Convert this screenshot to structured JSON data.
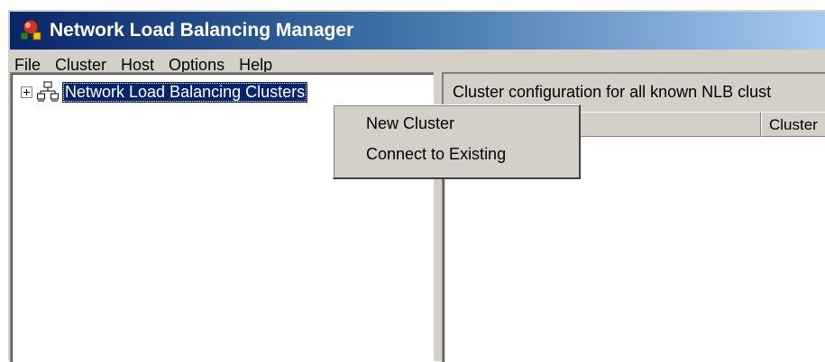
{
  "window": {
    "title": "Network Load Balancing Manager",
    "colors": {
      "title_gradient_start": "#0a246a",
      "title_gradient_end": "#a6caf0",
      "face": "#d4d0c8",
      "selection": "#0a246a"
    }
  },
  "menubar": {
    "items": [
      {
        "label": "File"
      },
      {
        "label": "Cluster"
      },
      {
        "label": "Host"
      },
      {
        "label": "Options"
      },
      {
        "label": "Help"
      }
    ]
  },
  "tree": {
    "root_label": "Network Load Balancing Clusters",
    "root_icon": "network-clusters-icon",
    "expanded": false
  },
  "right_pane": {
    "description": "Cluster configuration for all known NLB clust",
    "columns": [
      {
        "label": ""
      },
      {
        "label": "Cluster"
      }
    ]
  },
  "context_menu": {
    "items": [
      {
        "label": "New Cluster"
      },
      {
        "label": "Connect to Existing"
      }
    ]
  }
}
